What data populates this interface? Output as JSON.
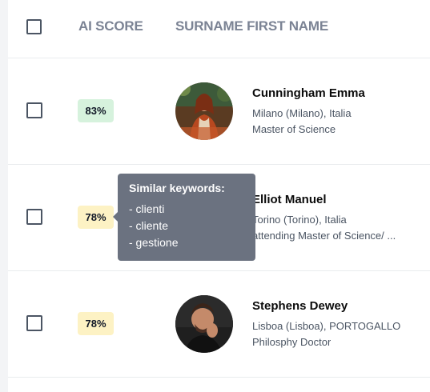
{
  "table": {
    "columns": {
      "ai_score": "AI SCORE",
      "surname_first_name": "SURNAME FIRST NAME"
    },
    "rows": [
      {
        "score": "83%",
        "score_level": "high",
        "name": "Cunningham Emma",
        "location": "Milano (Milano), Italia",
        "degree": "Master of Science",
        "avatar": "photo-woman-icon"
      },
      {
        "score": "78%",
        "score_level": "mid",
        "name": "Elliot Manuel",
        "location": "Torino (Torino), Italia",
        "degree": "attending Master of Science/ ...",
        "avatar": "photo-man-icon"
      },
      {
        "score": "78%",
        "score_level": "mid",
        "name": "Stephens Dewey",
        "location": "Lisboa (Lisboa), PORTOGALLO",
        "degree": "Philosphy Doctor",
        "avatar": "photo-man-icon"
      }
    ]
  },
  "tooltip": {
    "title": "Similar keywords:",
    "items": [
      "- clienti",
      "- cliente",
      "- gestione"
    ]
  },
  "colors": {
    "score_high_bg": "#d6f2dd",
    "score_mid_bg": "#fdf2c4",
    "tooltip_bg": "#6b7280",
    "header_text": "#7b8394"
  }
}
